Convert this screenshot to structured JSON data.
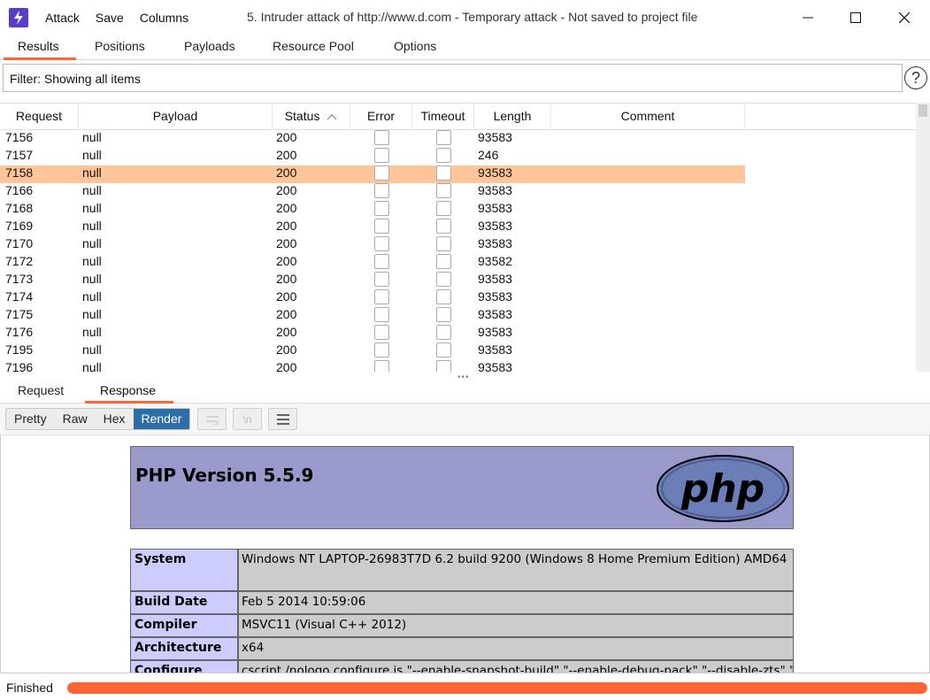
{
  "window": {
    "title": "5. Intruder attack of http://www.d.com - Temporary attack - Not saved to project file"
  },
  "menu": [
    "Attack",
    "Save",
    "Columns"
  ],
  "tabs": [
    "Results",
    "Positions",
    "Payloads",
    "Resource Pool",
    "Options"
  ],
  "active_tab": "Results",
  "filter": {
    "text": "Filter: Showing all items"
  },
  "table": {
    "columns": [
      "Request",
      "Payload",
      "Status",
      "Error",
      "Timeout",
      "Length",
      "Comment"
    ],
    "sort_column": "Status",
    "rows": [
      {
        "request": "7156",
        "payload": "null",
        "status": "200",
        "length": "93583",
        "selected": false
      },
      {
        "request": "7157",
        "payload": "null",
        "status": "200",
        "length": "246",
        "selected": false
      },
      {
        "request": "7158",
        "payload": "null",
        "status": "200",
        "length": "93583",
        "selected": true
      },
      {
        "request": "7166",
        "payload": "null",
        "status": "200",
        "length": "93583",
        "selected": false
      },
      {
        "request": "7168",
        "payload": "null",
        "status": "200",
        "length": "93583",
        "selected": false
      },
      {
        "request": "7169",
        "payload": "null",
        "status": "200",
        "length": "93583",
        "selected": false
      },
      {
        "request": "7170",
        "payload": "null",
        "status": "200",
        "length": "93583",
        "selected": false
      },
      {
        "request": "7172",
        "payload": "null",
        "status": "200",
        "length": "93582",
        "selected": false
      },
      {
        "request": "7173",
        "payload": "null",
        "status": "200",
        "length": "93583",
        "selected": false
      },
      {
        "request": "7174",
        "payload": "null",
        "status": "200",
        "length": "93583",
        "selected": false
      },
      {
        "request": "7175",
        "payload": "null",
        "status": "200",
        "length": "93583",
        "selected": false
      },
      {
        "request": "7176",
        "payload": "null",
        "status": "200",
        "length": "93583",
        "selected": false
      },
      {
        "request": "7195",
        "payload": "null",
        "status": "200",
        "length": "93583",
        "selected": false
      },
      {
        "request": "7196",
        "payload": "null",
        "status": "200",
        "length": "93583",
        "selected": false
      }
    ]
  },
  "detail_tabs": [
    "Request",
    "Response"
  ],
  "active_detail_tab": "Response",
  "view_buttons": [
    "Pretty",
    "Raw",
    "Hex",
    "Render"
  ],
  "active_view": "Render",
  "tool_buttons": [
    {
      "icon": "wrap-icon",
      "glyph": "⇄",
      "enabled": false
    },
    {
      "icon": "newline-icon",
      "glyph": "\\n",
      "enabled": false
    },
    {
      "icon": "menu-icon",
      "glyph": "☰",
      "enabled": true
    }
  ],
  "render": {
    "php_title": "PHP Version 5.5.9",
    "logo_text": "php",
    "rows": [
      {
        "key": "System",
        "value": "Windows NT LAPTOP-26983T7D 6.2 build 9200 (Windows 8 Home Premium Edition) AMD64"
      },
      {
        "key": "Build Date",
        "value": "Feb 5 2014 10:59:06"
      },
      {
        "key": "Compiler",
        "value": "MSVC11 (Visual C++ 2012)"
      },
      {
        "key": "Architecture",
        "value": "x64"
      },
      {
        "key": "Configure",
        "value": "cscript /nologo configure.js \"--enable-snapshot-build\" \"--enable-debug-pack\" \"--disable-zts\" \"-"
      }
    ]
  },
  "status": {
    "text": "Finished",
    "progress": 1.0
  },
  "colors": {
    "accent": "#ff6633",
    "selected_row": "#ffc599",
    "render_active": "#2d6da8",
    "php_header": "#9999cc",
    "php_key": "#ccccff",
    "php_value": "#cccccc"
  }
}
